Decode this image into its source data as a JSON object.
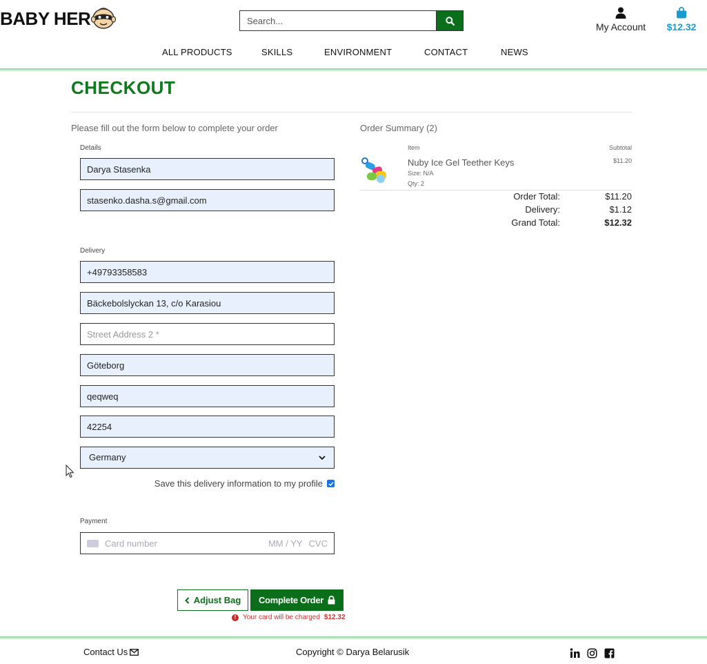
{
  "header": {
    "logo_text": "BABY HER",
    "search_placeholder": "Search...",
    "account_label": "My Account",
    "bag_total": "$12.32"
  },
  "nav": {
    "items": [
      "ALL PRODUCTS",
      "SKILLS",
      "ENVIRONMENT",
      "CONTACT",
      "NEWS"
    ]
  },
  "checkout": {
    "title": "CHECKOUT",
    "intro": "Please fill out the form below to complete your order",
    "details_label": "Details",
    "full_name": "Darya Stasenka",
    "email": "stasenko.dasha.s@gmail.com",
    "delivery_label": "Delivery",
    "phone": "+49793358583",
    "street1": "Bäckebolslyckan 13, c/o Karasiou",
    "street2_placeholder": "Street Address 2 *",
    "city": "Göteborg",
    "county": "qeqweq",
    "postcode": "42254",
    "country": "Germany",
    "save_label": "Save this delivery information to my profile",
    "save_checked": true,
    "payment_label": "Payment",
    "card_placeholder": "Card number",
    "exp_placeholder": "MM / YY",
    "cvc_placeholder": "CVC",
    "adjust_label": "Adjust Bag",
    "complete_label": "Complete Order",
    "charge_text": "Your card will be charged",
    "charge_amount": "$12.32"
  },
  "summary": {
    "title": "Order Summary (2)",
    "item_header": "Item",
    "subtotal_header": "Subtotal",
    "item_name": "Nuby Ice Gel Teether Keys",
    "item_size": "Size: N/A",
    "item_qty": "Qty: 2",
    "item_subtotal": "$11.20",
    "order_total_label": "Order Total:",
    "order_total": "$11.20",
    "delivery_label": "Delivery:",
    "delivery": "$1.12",
    "grand_total_label": "Grand Total:",
    "grand_total": "$12.32"
  },
  "footer": {
    "contact": "Contact Us",
    "copyright": "Copyright © Darya Belarusik"
  },
  "colors": {
    "brand_green": "#0a6e1a",
    "title_green": "#0e7a1c",
    "bag_blue": "#1a9bd0",
    "error_red": "#d03030",
    "autofill_bg": "#e8f0fe"
  }
}
